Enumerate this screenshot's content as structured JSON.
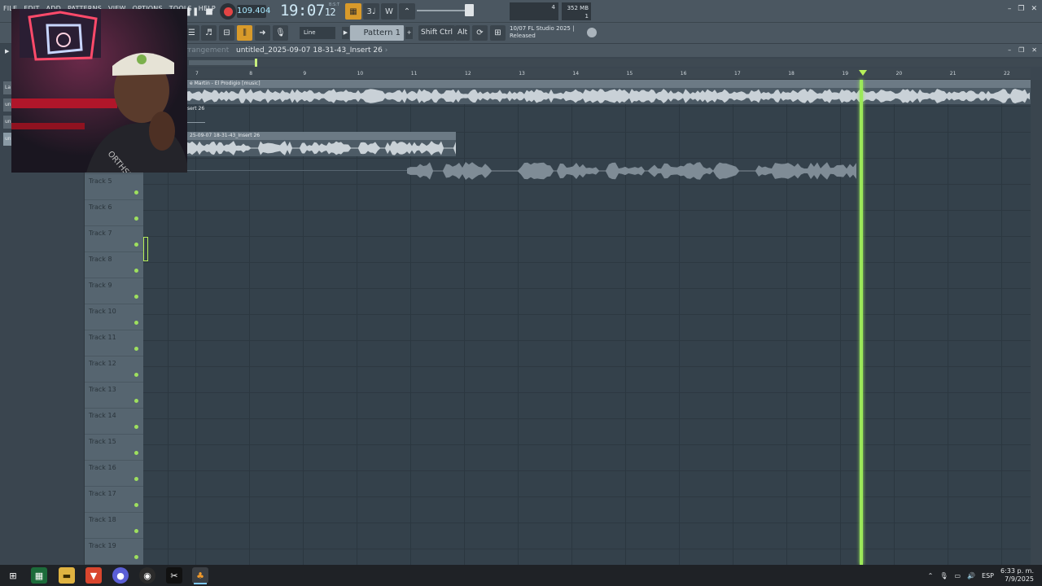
{
  "menu": [
    "FILE",
    "EDIT",
    "ADD",
    "PATTERNS",
    "VIEW",
    "OPTIONS",
    "TOOLS",
    "HELP"
  ],
  "transport": {
    "tempo": "109.404",
    "time_main": "19:07",
    "time_small": "12",
    "time_sub": "B:S:T"
  },
  "cpu": {
    "memory": "352 MB",
    "polyphony": "1",
    "count": "4"
  },
  "toolbar": {
    "snap_mode": "Line",
    "pattern": "Pattern 1",
    "keys": [
      "Shift",
      "Ctrl",
      "Alt"
    ],
    "hint_line1": "10/07  FL Studio 2025 |",
    "hint_line2": "Released"
  },
  "left_tabs": [
    "La",
    "un",
    "un",
    "un"
  ],
  "playlist": {
    "title_prefix": "rrangement",
    "breadcrumb": "untitled_2025-09-07 18-31-43_Insert 26",
    "ruler": [
      "7",
      "8",
      "9",
      "10",
      "11",
      "12",
      "13",
      "14",
      "15",
      "16",
      "17",
      "18",
      "19",
      "20",
      "21",
      "22"
    ],
    "clips": {
      "music": "e Martin - El Prodigio [music]",
      "insert_short": "sert 26",
      "insert_full": "25-09-07 18-31-43_Insert 26"
    },
    "tracks": [
      "Track 5",
      "Track 6",
      "Track 7",
      "Track 8",
      "Track 9",
      "Track 10",
      "Track 11",
      "Track 12",
      "Track 13",
      "Track 14",
      "Track 15",
      "Track 16",
      "Track 17",
      "Track 18",
      "Track 19"
    ]
  },
  "webcam": {
    "shirt_text": "ORTHSIDE"
  },
  "taskbar": {
    "language": "ESP",
    "time": "6:33 p. m.",
    "date": "7/9/2025"
  },
  "colors": {
    "accent": "#d89a2a",
    "playhead": "#9be85a",
    "record": "#e24444"
  }
}
